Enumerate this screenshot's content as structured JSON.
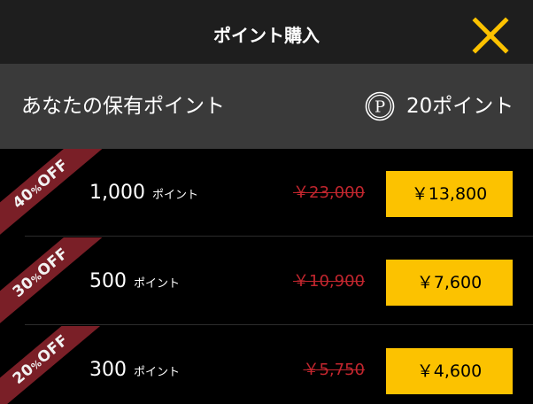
{
  "header": {
    "title": "ポイント購入",
    "close_icon": "close-icon",
    "accent_color": "#fcc200"
  },
  "balance": {
    "label": "あなたの保有ポイント",
    "icon": "points-coin-icon",
    "icon_letter": "P",
    "value": "20ポイント"
  },
  "offers": [
    {
      "discount": "40",
      "discount_suffix": "%",
      "discount_word": "OFF",
      "points": "1,000",
      "unit": "ポイント",
      "original_price": "￥23,000",
      "price": "￥13,800"
    },
    {
      "discount": "30",
      "discount_suffix": "%",
      "discount_word": "OFF",
      "points": "500",
      "unit": "ポイント",
      "original_price": "￥10,900",
      "price": "￥7,600"
    },
    {
      "discount": "20",
      "discount_suffix": "%",
      "discount_word": "OFF",
      "points": "300",
      "unit": "ポイント",
      "original_price": "￥5,750",
      "price": "￥4,600"
    }
  ],
  "colors": {
    "ribbon": "#7a1f27",
    "strikethrough_price": "#c2262e",
    "buy_button": "#fcc200"
  }
}
